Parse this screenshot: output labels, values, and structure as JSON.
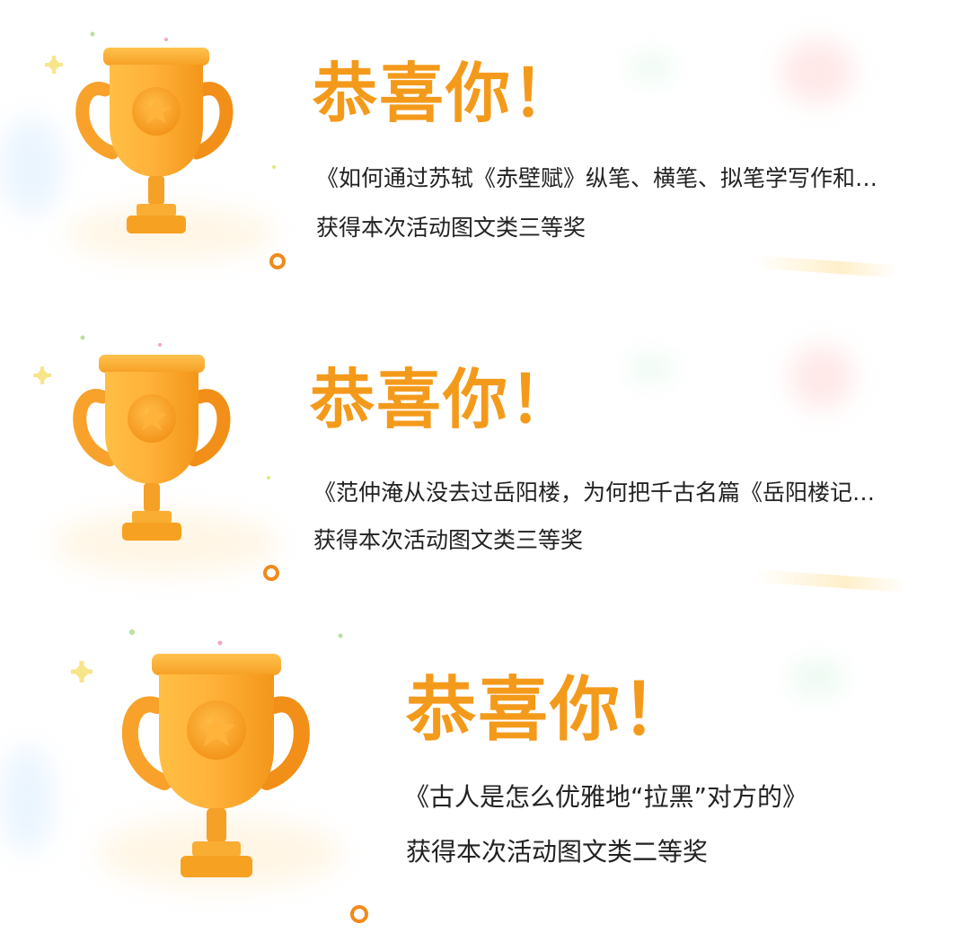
{
  "awards": [
    {
      "headline": "恭喜你！",
      "article_title": "《如何通过苏轼《赤壁赋》纵笔、横笔、拟笔学写作和…",
      "award_text": "获得本次活动图文类三等奖"
    },
    {
      "headline": "恭喜你！",
      "article_title": "《范仲淹从没去过岳阳楼，为何把千古名篇《岳阳楼记…",
      "award_text": "获得本次活动图文类三等奖"
    },
    {
      "headline": "恭喜你！",
      "article_title": "《古人是怎么优雅地“拉黑”对方的》",
      "award_text": "获得本次活动图文类二等奖"
    }
  ],
  "icons": {
    "trophy": "trophy-icon",
    "star": "star-icon",
    "sparkle": "sparkle-icon",
    "ring": "ring-decoration"
  },
  "colors": {
    "headline": "#f49a1b",
    "trophy_main": "#ffab2e",
    "trophy_dark": "#f28a12",
    "text": "#222222"
  }
}
